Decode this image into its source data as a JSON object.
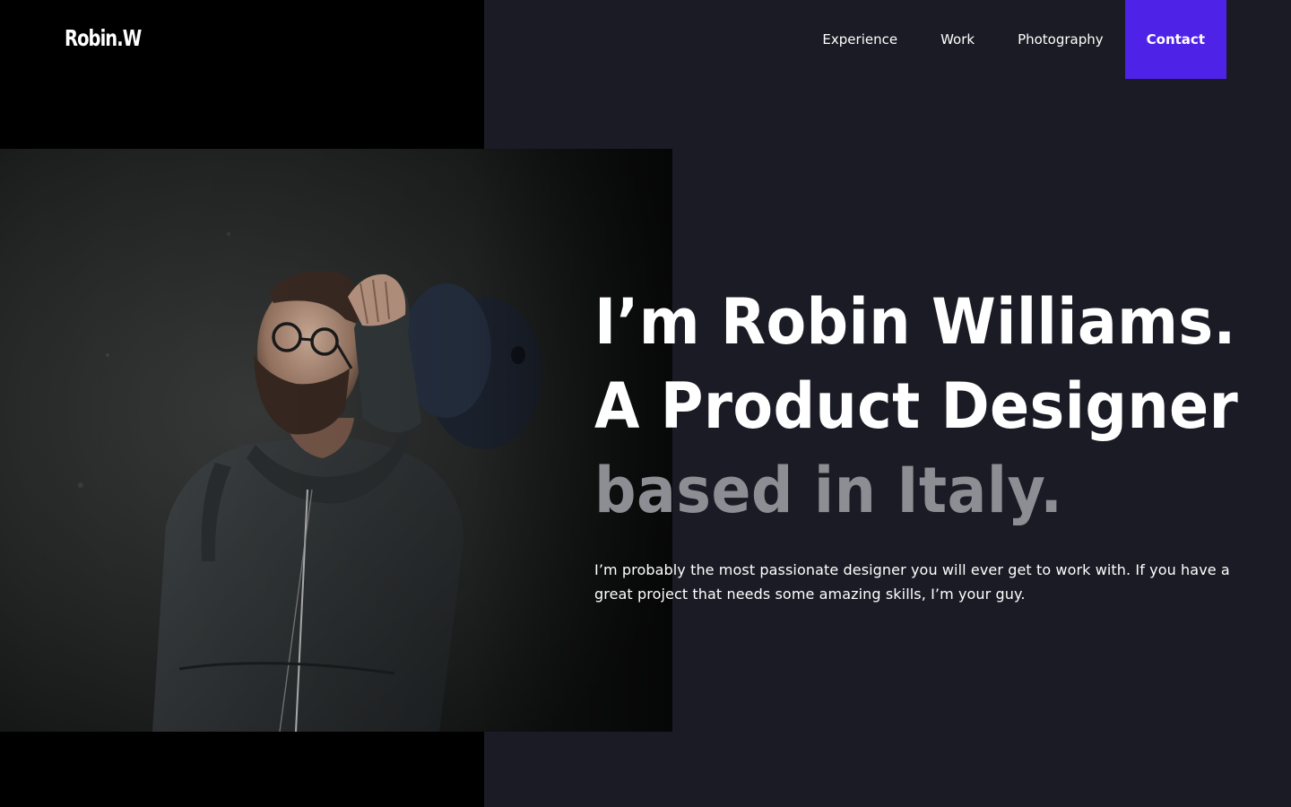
{
  "header": {
    "logo": "Robin.W",
    "nav": [
      {
        "label": "Experience"
      },
      {
        "label": "Work"
      },
      {
        "label": "Photography"
      },
      {
        "label": "Contact"
      }
    ]
  },
  "hero": {
    "line1": "I’m Robin Williams.",
    "line2": "A Product Designer",
    "line3": "based in Italy.",
    "intro": "I’m probably the most passionate designer you will ever get to work with. If you have a great project that needs some amazing skills, I’m your guy."
  },
  "colors": {
    "accent": "#4f22e8",
    "background_dark": "#1b1b25",
    "panel_black": "#000000",
    "muted_text": "#8d8e93"
  },
  "image": {
    "subject": "portrait of a bearded man with glasses holding a cap behind his head"
  }
}
